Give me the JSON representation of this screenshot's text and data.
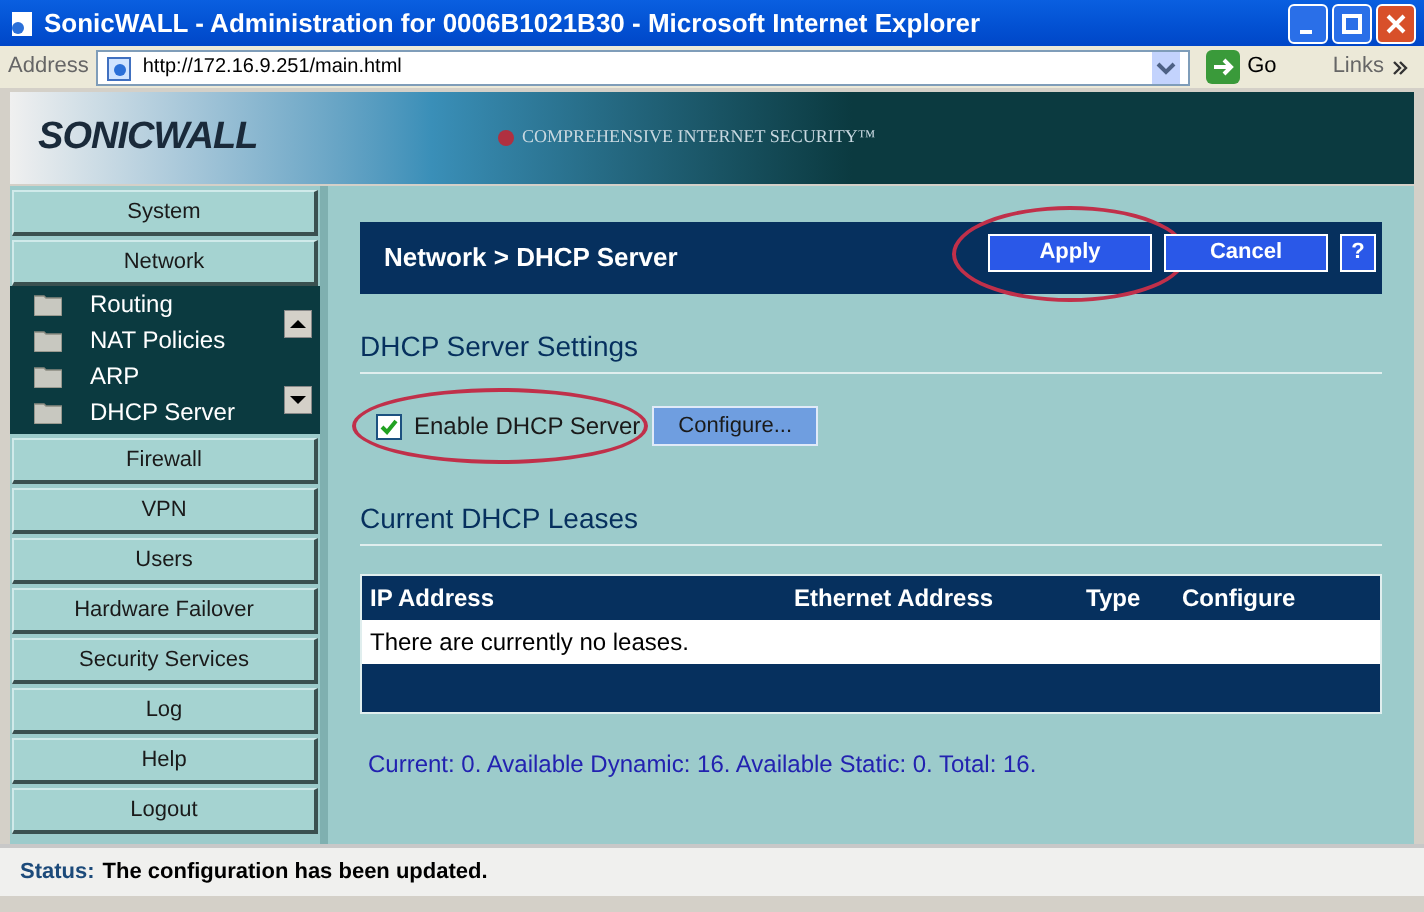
{
  "window": {
    "title": "SonicWALL - Administration for 0006B1021B30 - Microsoft Internet Explorer"
  },
  "address_bar": {
    "label": "Address",
    "url": "http://172.16.9.251/main.html",
    "go": "Go",
    "links": "Links"
  },
  "banner": {
    "logo": "SONICWALL",
    "tagline": "COMPREHENSIVE INTERNET SECURITY™"
  },
  "sidebar": {
    "items": [
      {
        "label": "System"
      },
      {
        "label": "Network",
        "children": [
          {
            "label": "Routing"
          },
          {
            "label": "NAT Policies"
          },
          {
            "label": "ARP"
          },
          {
            "label": "DHCP Server"
          }
        ]
      },
      {
        "label": "Firewall"
      },
      {
        "label": "VPN"
      },
      {
        "label": "Users"
      },
      {
        "label": "Hardware Failover"
      },
      {
        "label": "Security Services"
      },
      {
        "label": "Log"
      },
      {
        "label": "Help"
      },
      {
        "label": "Logout"
      }
    ]
  },
  "header": {
    "title": "Network > DHCP Server",
    "buttons": [
      {
        "label": "Apply",
        "highlighted": true
      },
      {
        "label": "Cancel",
        "highlighted": false
      },
      {
        "label": "?",
        "highlighted": false
      }
    ]
  },
  "settings": {
    "heading": "DHCP Server Settings",
    "enable": {
      "label": "Enable DHCP Server",
      "checked": true,
      "highlighted": true
    },
    "configure_button": "Configure..."
  },
  "leases": {
    "heading": "Current DHCP Leases",
    "columns": [
      "IP Address",
      "Ethernet Address",
      "Type",
      "Configure"
    ],
    "empty_message": "There are currently no leases.",
    "summary": "Current: 0. Available Dynamic: 16. Available Static: 0. Total: 16."
  },
  "status_bar": {
    "label": "Status:",
    "message": "The configuration has been updated."
  }
}
